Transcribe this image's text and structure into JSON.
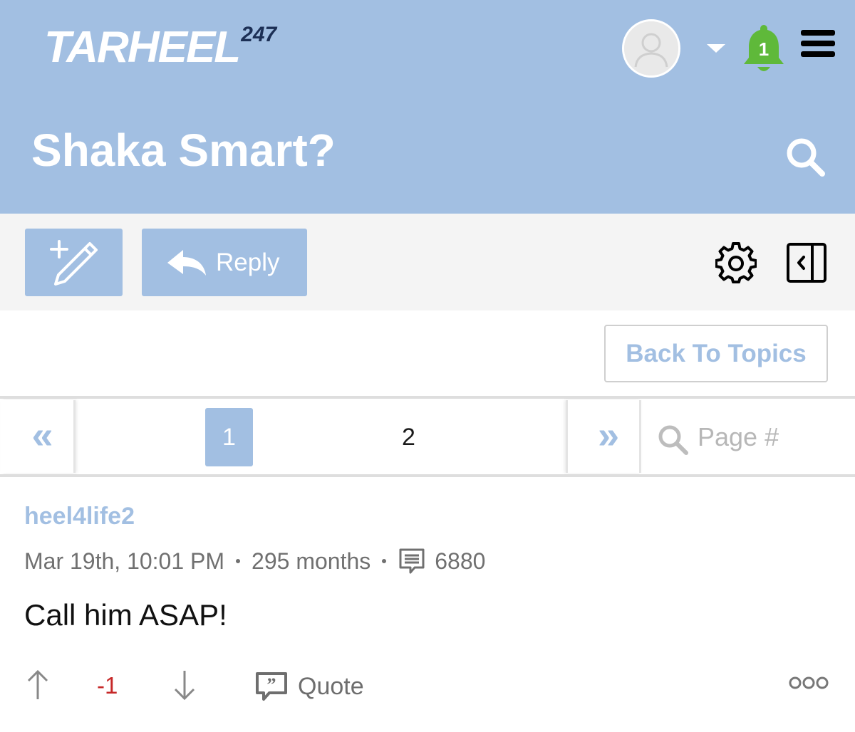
{
  "header": {
    "logo_text": "TarHeel",
    "logo_number": "247",
    "notification_count": "1",
    "title": "Shaka Smart?"
  },
  "toolbar": {
    "reply_label": "Reply"
  },
  "navigation": {
    "back_label": "Back To Topics"
  },
  "pagination": {
    "prev_symbol": "«",
    "current_page": "1",
    "other_page": "2",
    "next_symbol": "»",
    "search_placeholder": "Page #"
  },
  "post": {
    "author": "heel4life2",
    "date": "Mar 19th, 10:01 PM",
    "tenure": "295 months",
    "post_count": "6880",
    "body": "Call him ASAP!",
    "score": "-1",
    "quote_label": "Quote"
  },
  "colors": {
    "brand": "#a2bfe2",
    "bell": "#5fb93a",
    "negative_score": "#c62828"
  },
  "icons": [
    "user-avatar-icon",
    "caret-down-icon",
    "bell-icon",
    "menu-icon",
    "search-icon",
    "new-post-icon",
    "reply-arrow-icon",
    "gear-icon",
    "collapse-panel-icon",
    "upvote-icon",
    "downvote-icon",
    "quote-icon",
    "comments-icon",
    "more-icon"
  ]
}
